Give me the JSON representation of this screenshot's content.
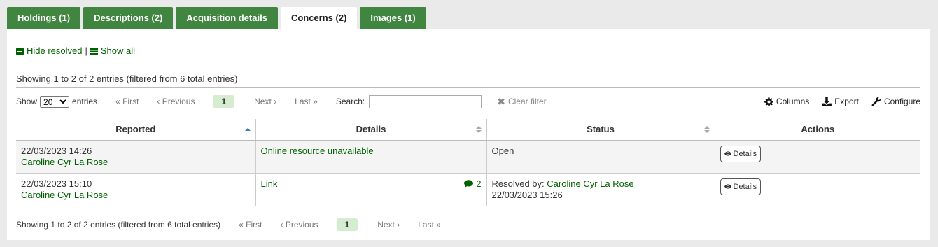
{
  "tabs": [
    {
      "label": "Holdings (1)"
    },
    {
      "label": "Descriptions (2)"
    },
    {
      "label": "Acquisition details"
    },
    {
      "label": "Concerns (2)"
    },
    {
      "label": "Images (1)"
    }
  ],
  "active_tab": "Concerns (2)",
  "filters": {
    "hide_resolved": "Hide resolved",
    "separator": "|",
    "show_all": "Show all"
  },
  "info_text": "Showing 1 to 2 of 2 entries (filtered from 6 total entries)",
  "toolbar": {
    "show_label": "Show",
    "page_size": "20",
    "entries_label": "entries",
    "search_label": "Search:",
    "search_value": "",
    "clear_filter": "Clear filter",
    "columns": "Columns",
    "export": "Export",
    "configure": "Configure"
  },
  "pager": {
    "first": "First",
    "previous": "Previous",
    "current": "1",
    "next": "Next",
    "last": "Last"
  },
  "table": {
    "headers": [
      "Reported",
      "Details",
      "Status",
      "Actions"
    ],
    "rows": [
      {
        "date": "22/03/2023 14:26",
        "reporter": "Caroline Cyr La Rose",
        "detail": "Online resource unavailable",
        "comments": "",
        "status": "Open",
        "resolved_by_label": "",
        "resolved_by": "",
        "resolved_date": "",
        "action": "Details"
      },
      {
        "date": "22/03/2023 15:10",
        "reporter": "Caroline Cyr La Rose",
        "detail": "Link",
        "comments": "2",
        "status": "",
        "resolved_by_label": "Resolved by:",
        "resolved_by": "Caroline Cyr La Rose",
        "resolved_date": "22/03/2023 15:26",
        "action": "Details"
      }
    ]
  },
  "colors": {
    "tab_green": "#408540",
    "link_green": "#006100",
    "sort_active": "#3a7bc8",
    "current_page_bg": "#d5ecd0"
  },
  "icons": {
    "hide_resolved": "minus-square-icon",
    "show_all": "bars-icon",
    "clear": "times-icon",
    "columns": "gear-icon",
    "export": "download-icon",
    "configure": "wrench-icon",
    "details": "eye-icon",
    "comments": "comment-icon"
  }
}
